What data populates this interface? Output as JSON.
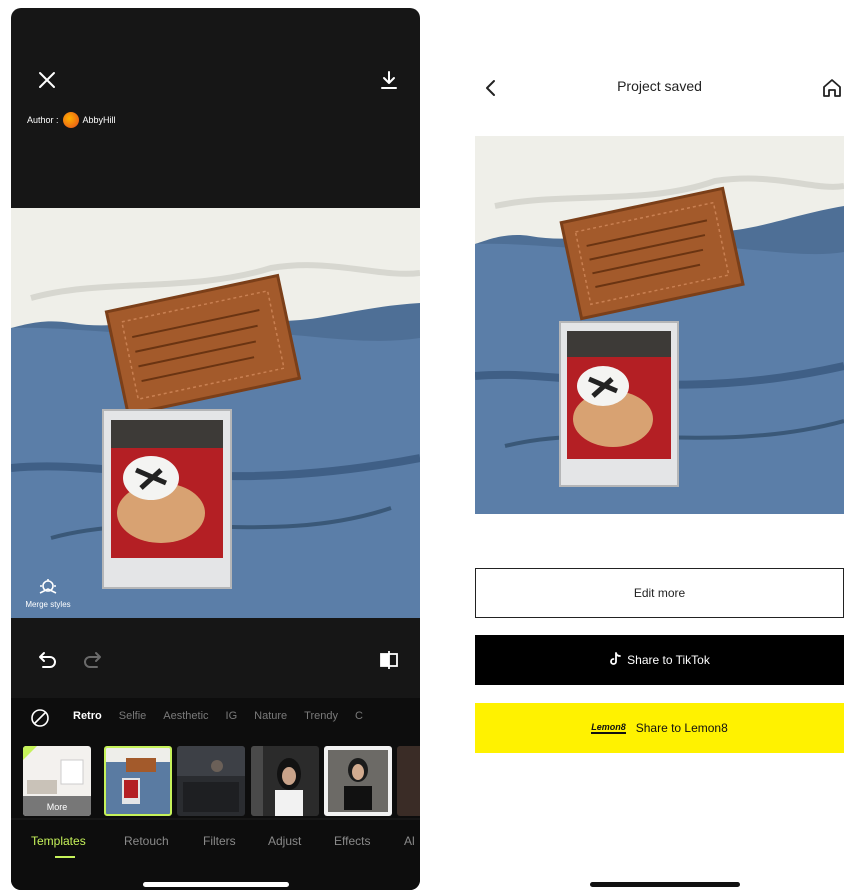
{
  "left_screen": {
    "author_prefix": "Author :",
    "author_name": "AbbyHill",
    "merge_label": "Merge styles",
    "filter_categories": [
      "Retro",
      "Selfie",
      "Aesthetic",
      "IG",
      "Nature",
      "Trendy",
      "C"
    ],
    "thumb_more_label": "More",
    "bottom_tabs": [
      "Templates",
      "Retouch",
      "Filters",
      "Adjust",
      "Effects",
      "Al"
    ],
    "icons": {
      "close": "close-icon",
      "download": "download-icon",
      "undo": "undo-icon",
      "redo": "redo-icon",
      "compare": "compare-icon",
      "none": "no-filter-icon",
      "merge": "merge-styles-icon"
    }
  },
  "right_screen": {
    "title": "Project saved",
    "edit_more_label": "Edit more",
    "share_tiktok_label": "Share to TikTok",
    "share_lemon8_label": "Share to Lemon8",
    "lemon8_logo_text": "Lemon8",
    "icons": {
      "back": "back-chevron-icon",
      "home": "home-icon",
      "tiktok": "tiktok-icon"
    }
  },
  "colors": {
    "accent_green": "#c6f25a",
    "lemon8_yellow": "#fff200",
    "tiktok_black": "#000000",
    "dark_bg": "#161616"
  }
}
